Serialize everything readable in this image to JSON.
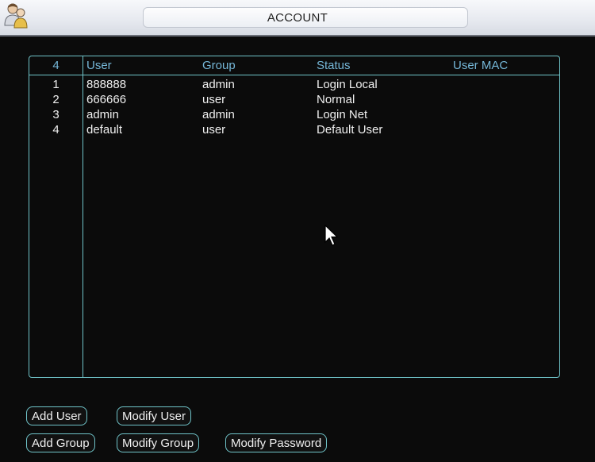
{
  "window": {
    "title": "ACCOUNT"
  },
  "table": {
    "headers": {
      "num": "4",
      "user": "User",
      "group": "Group",
      "status": "Status",
      "mac": "User MAC"
    },
    "rows": [
      {
        "num": "1",
        "user": "888888",
        "group": "admin",
        "status": "Login Local",
        "mac": ""
      },
      {
        "num": "2",
        "user": "666666",
        "group": "user",
        "status": "Normal",
        "mac": ""
      },
      {
        "num": "3",
        "user": "admin",
        "group": "admin",
        "status": "Login Net",
        "mac": ""
      },
      {
        "num": "4",
        "user": "default",
        "group": "user",
        "status": "Default User",
        "mac": ""
      }
    ]
  },
  "buttons": {
    "add_user": "Add User",
    "modify_user": "Modify User",
    "add_group": "Add Group",
    "modify_group": "Modify Group",
    "modify_password": "Modify Password"
  },
  "colors": {
    "accent": "#6fc3c8",
    "header_text": "#75b7d8",
    "background": "#0b0b0b"
  },
  "icons": {
    "title": "users-icon",
    "pointer": "mouse-cursor-icon"
  }
}
